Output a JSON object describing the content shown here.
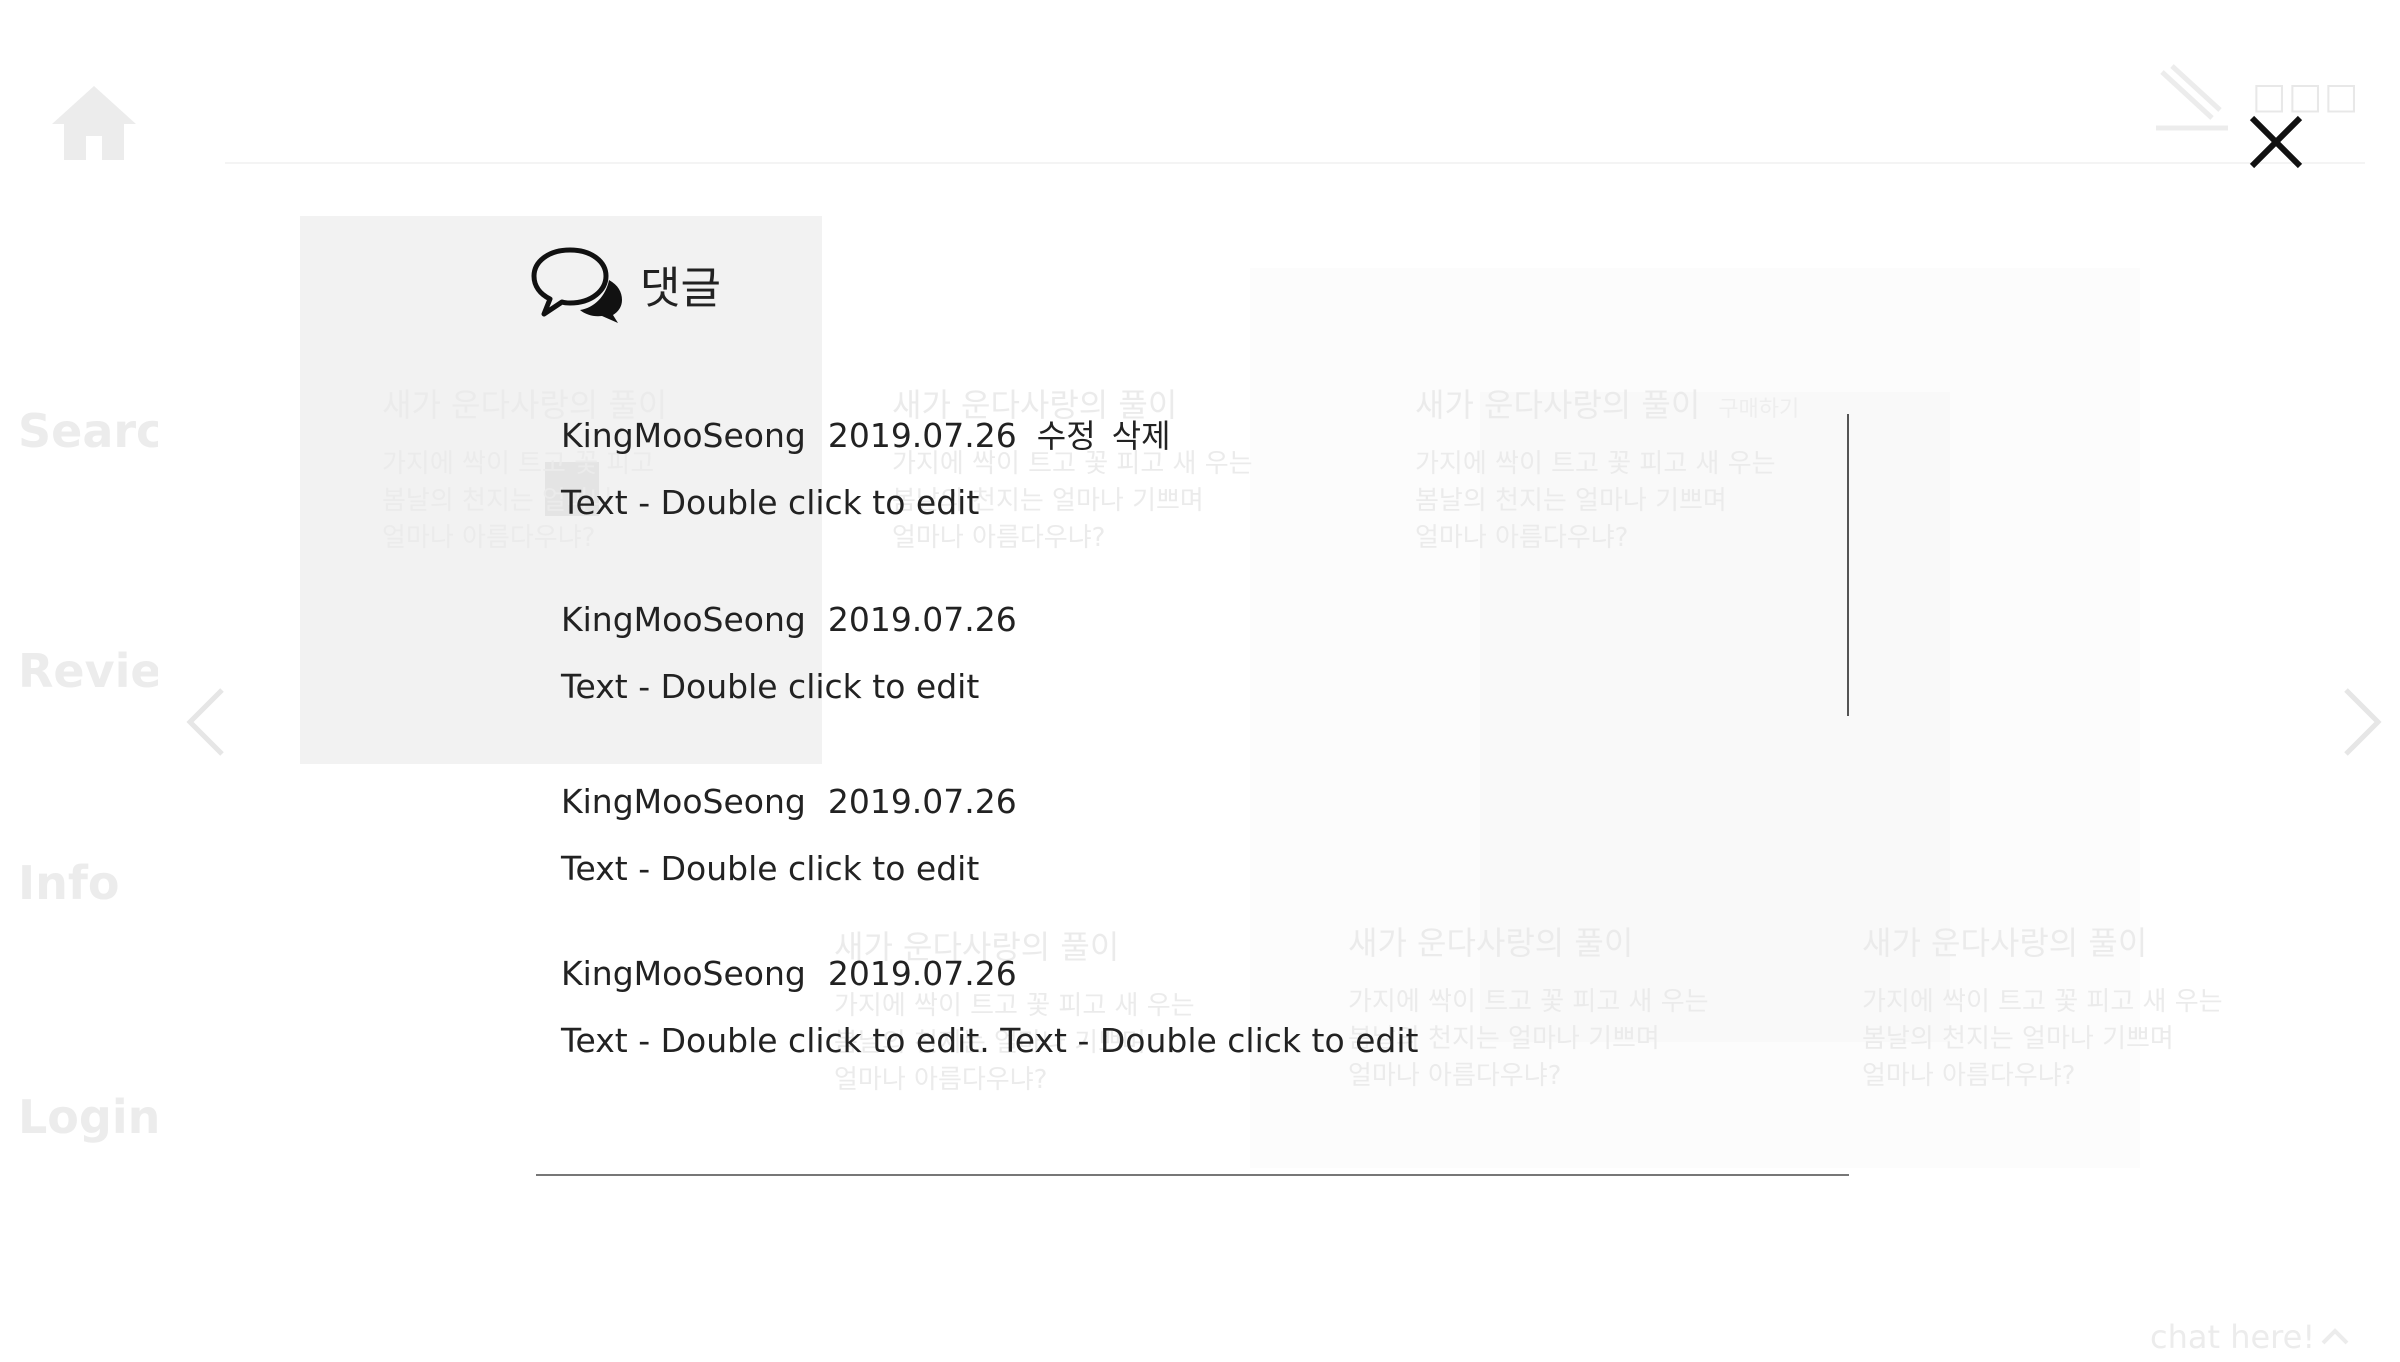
{
  "background": {
    "nav": {
      "search": "Searc",
      "review": "Revie",
      "info": "Info",
      "login": "Login"
    },
    "top_right_label": "□□□",
    "cards": [
      {
        "title": "새가 운다사랑의 풀이",
        "lines": [
          "가지에 싹이 트고 꽃 피고",
          "봄날의 천지는 얼마나",
          "얼마나 아름다우냐?"
        ]
      },
      {
        "title": "새가 운다사랑의 풀이",
        "lines": [
          "가지에 싹이 트고 꽃 피고 새 우는",
          "봄날의 천지는 얼마나 기쁘며",
          "얼마나 아름다우냐?"
        ]
      },
      {
        "title": "새가 운다사랑의 풀이",
        "subtitle": "구매하기",
        "lines": [
          "가지에 싹이 트고 꽃 피고 새 우는",
          "봄날의 천지는 얼마나 기쁘며",
          "얼마나 아름다우냐?"
        ]
      },
      {
        "title": "새가 운다사랑의 풀이",
        "lines": [
          "가지에 싹이 트고 꽃 피고 새 우는",
          "봄날의 천지는 얼마나 기쁘며",
          "얼마나 아름다우냐?"
        ]
      },
      {
        "title": "새가 운다사랑의 풀이",
        "lines": [
          "가지에 싹이 트고 꽃 피고 새 우는",
          "봄날의 천지는 얼마나 기쁘며",
          "얼마나 아름다우냐?"
        ]
      },
      {
        "title": "새가 운다사랑의 풀이",
        "lines": [
          "가지에 싹이 트고 꽃 피고 새 우는",
          "봄날의 천지는 얼마나 기쁘며",
          "얼마나 아름다우냐?"
        ]
      }
    ],
    "chat_label": "chat here!"
  },
  "modal": {
    "title": "댓글",
    "icons": {
      "close": "close-icon",
      "comment": "speech-bubbles-icon"
    },
    "comments": [
      {
        "author": "KingMooSeong",
        "date": "2019.07.26",
        "edit_label": "수정",
        "delete_label": "삭제",
        "text": "Text - Double click to edit"
      },
      {
        "author": "KingMooSeong",
        "date": "2019.07.26",
        "text": "Text - Double click to edit"
      },
      {
        "author": "KingMooSeong",
        "date": "2019.07.26",
        "text": "Text - Double click to edit"
      },
      {
        "author": "KingMooSeong",
        "date": "2019.07.26",
        "text": "Text - Double click to edit. Text - Double click to edit"
      }
    ]
  },
  "colors": {
    "text": "#222222",
    "faded": "#ebebeb",
    "divider": "#777777"
  }
}
